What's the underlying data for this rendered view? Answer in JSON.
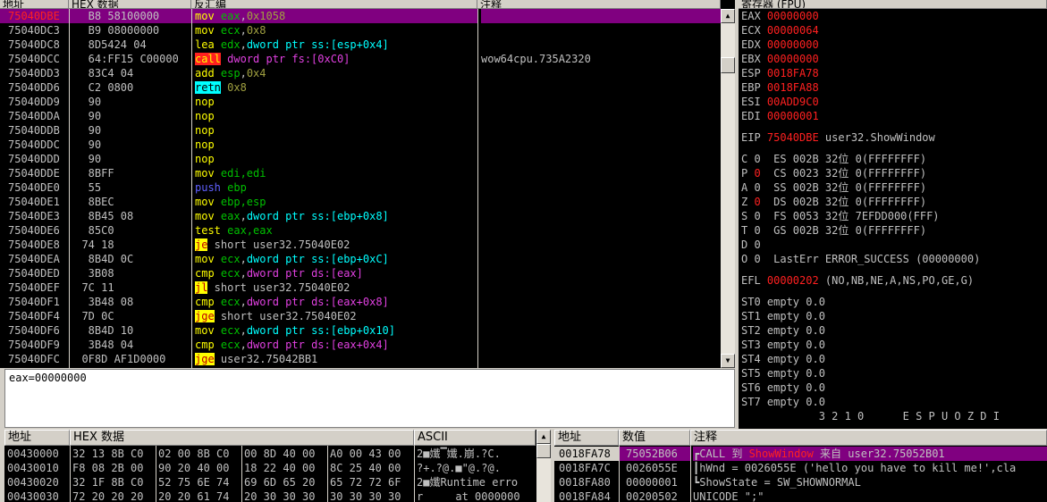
{
  "disasm": {
    "headers": [
      "地址",
      "HEX 数据",
      "反汇编",
      "注释"
    ],
    "rows": [
      {
        "addr": "75040DBE",
        "hex": "B8 58100000",
        "ops": [
          [
            "mov ",
            "y"
          ],
          [
            "eax",
            "g"
          ],
          [
            ",",
            "w"
          ],
          [
            "0x1058",
            "ol"
          ]
        ],
        "comment": "",
        "selected": true
      },
      {
        "addr": "75040DC3",
        "hex": "B9 08000000",
        "ops": [
          [
            "mov ",
            "y"
          ],
          [
            "ecx",
            "g"
          ],
          [
            ",",
            "w"
          ],
          [
            "0x8",
            "ol"
          ]
        ],
        "comment": ""
      },
      {
        "addr": "75040DC8",
        "hex": "8D5424 04",
        "ops": [
          [
            "lea ",
            "y"
          ],
          [
            "edx",
            "g"
          ],
          [
            ",",
            "w"
          ],
          [
            "dword ptr ss:[esp+0x4]",
            "cy"
          ]
        ],
        "comment": ""
      },
      {
        "addr": "75040DCC",
        "hex": "64:FF15 C00000",
        "ops": [
          [
            "call",
            "callbox"
          ],
          [
            " dword ptr fs:[0xC0]",
            "m"
          ]
        ],
        "comment": "wow64cpu.735A2320"
      },
      {
        "addr": "75040DD3",
        "hex": "83C4 04",
        "ops": [
          [
            "add ",
            "y"
          ],
          [
            "esp",
            "g"
          ],
          [
            ",",
            "w"
          ],
          [
            "0x4",
            "ol"
          ]
        ],
        "comment": ""
      },
      {
        "addr": "75040DD6",
        "hex": "C2 0800",
        "ops": [
          [
            "retn",
            "retbox"
          ],
          [
            " 0x8",
            "ol"
          ]
        ],
        "comment": ""
      },
      {
        "addr": "75040DD9",
        "hex": "90",
        "ops": [
          [
            "nop",
            "y"
          ]
        ],
        "comment": ""
      },
      {
        "addr": "75040DDA",
        "hex": "90",
        "ops": [
          [
            "nop",
            "y"
          ]
        ],
        "comment": ""
      },
      {
        "addr": "75040DDB",
        "hex": "90",
        "ops": [
          [
            "nop",
            "y"
          ]
        ],
        "comment": ""
      },
      {
        "addr": "75040DDC",
        "hex": "90",
        "ops": [
          [
            "nop",
            "y"
          ]
        ],
        "comment": ""
      },
      {
        "addr": "75040DDD",
        "hex": "90",
        "ops": [
          [
            "nop",
            "y"
          ]
        ],
        "comment": ""
      },
      {
        "addr": "75040DDE",
        "hex": "8BFF",
        "ops": [
          [
            "mov ",
            "y"
          ],
          [
            "edi,edi",
            "g"
          ]
        ],
        "comment": ""
      },
      {
        "addr": "75040DE0",
        "hex": "55",
        "ops": [
          [
            "push ",
            "pushc"
          ],
          [
            "ebp",
            "g"
          ]
        ],
        "comment": ""
      },
      {
        "addr": "75040DE1",
        "hex": "8BEC",
        "ops": [
          [
            "mov ",
            "y"
          ],
          [
            "ebp,esp",
            "g"
          ]
        ],
        "comment": ""
      },
      {
        "addr": "75040DE3",
        "hex": "8B45 08",
        "ops": [
          [
            "mov ",
            "y"
          ],
          [
            "eax",
            "g"
          ],
          [
            ",",
            "w"
          ],
          [
            "dword ptr ss:[ebp+0x8]",
            "cy"
          ]
        ],
        "comment": ""
      },
      {
        "addr": "75040DE6",
        "hex": "85C0",
        "ops": [
          [
            "test ",
            "y"
          ],
          [
            "eax,eax",
            "g"
          ]
        ],
        "comment": ""
      },
      {
        "addr": "75040DE8",
        "hex": "74 18",
        "ops": [
          [
            "je",
            "jbox"
          ],
          [
            " short user32.75040E02",
            "w"
          ]
        ],
        "comment": "",
        "hexarrow": true
      },
      {
        "addr": "75040DEA",
        "hex": "8B4D 0C",
        "ops": [
          [
            "mov ",
            "y"
          ],
          [
            "ecx",
            "g"
          ],
          [
            ",",
            "w"
          ],
          [
            "dword ptr ss:[ebp+0xC]",
            "cy"
          ]
        ],
        "comment": ""
      },
      {
        "addr": "75040DED",
        "hex": "3B08",
        "ops": [
          [
            "cmp ",
            "y"
          ],
          [
            "ecx",
            "g"
          ],
          [
            ",",
            "w"
          ],
          [
            "dword ptr ds:[eax]",
            "m"
          ]
        ],
        "comment": ""
      },
      {
        "addr": "75040DEF",
        "hex": "7C 11",
        "ops": [
          [
            "jl",
            "jbox"
          ],
          [
            " short user32.75040E02",
            "w"
          ]
        ],
        "comment": "",
        "hexarrow": true
      },
      {
        "addr": "75040DF1",
        "hex": "3B48 08",
        "ops": [
          [
            "cmp ",
            "y"
          ],
          [
            "ecx",
            "g"
          ],
          [
            ",",
            "w"
          ],
          [
            "dword ptr ds:[eax+0x8]",
            "m"
          ]
        ],
        "comment": ""
      },
      {
        "addr": "75040DF4",
        "hex": "7D 0C",
        "ops": [
          [
            "jge",
            "jbox"
          ],
          [
            " short user32.75040E02",
            "w"
          ]
        ],
        "comment": "",
        "hexarrow": true
      },
      {
        "addr": "75040DF6",
        "hex": "8B4D 10",
        "ops": [
          [
            "mov ",
            "y"
          ],
          [
            "ecx",
            "g"
          ],
          [
            ",",
            "w"
          ],
          [
            "dword ptr ss:[ebp+0x10]",
            "cy"
          ]
        ],
        "comment": ""
      },
      {
        "addr": "75040DF9",
        "hex": "3B48 04",
        "ops": [
          [
            "cmp ",
            "y"
          ],
          [
            "ecx",
            "g"
          ],
          [
            ",",
            "w"
          ],
          [
            "dword ptr ds:[eax+0x4]",
            "m"
          ]
        ],
        "comment": ""
      },
      {
        "addr": "75040DFC",
        "hex": "0F8D AF1D0000",
        "ops": [
          [
            "jge",
            "jbox"
          ],
          [
            " user32.75042BB1",
            "w"
          ]
        ],
        "comment": "",
        "hexarrow": true
      }
    ]
  },
  "info_line": "eax=00000000",
  "registers": {
    "title": "寄存器 (FPU)",
    "gp": [
      [
        "EAX",
        "00000000"
      ],
      [
        "ECX",
        "00000064"
      ],
      [
        "EDX",
        "00000000"
      ],
      [
        "EBX",
        "00000000"
      ],
      [
        "ESP",
        "0018FA78"
      ],
      [
        "EBP",
        "0018FA88"
      ],
      [
        "ESI",
        "00ADD9C0"
      ],
      [
        "EDI",
        "00000001"
      ]
    ],
    "eip": {
      "name": "EIP",
      "value": "75040DBE",
      "sym": "user32.ShowWindow"
    },
    "flags": [
      {
        "f": "C",
        "v": "0",
        "red": false,
        "seg": "ES 002B 32位 0(FFFFFFFF)"
      },
      {
        "f": "P",
        "v": "0",
        "red": true,
        "seg": "CS 0023 32位 0(FFFFFFFF)"
      },
      {
        "f": "A",
        "v": "0",
        "red": false,
        "seg": "SS 002B 32位 0(FFFFFFFF)"
      },
      {
        "f": "Z",
        "v": "0",
        "red": true,
        "seg": "DS 002B 32位 0(FFFFFFFF)"
      },
      {
        "f": "S",
        "v": "0",
        "red": false,
        "seg": "FS 0053 32位 7EFDD000(FFF)"
      },
      {
        "f": "T",
        "v": "0",
        "red": false,
        "seg": "GS 002B 32位 0(FFFFFFFF)"
      },
      {
        "f": "D",
        "v": "0",
        "red": false,
        "seg": ""
      },
      {
        "f": "O",
        "v": "0",
        "red": false,
        "seg": "LastErr ERROR_SUCCESS (00000000)"
      }
    ],
    "efl": {
      "name": "EFL",
      "value": "00000202",
      "desc": "(NO,NB,NE,A,NS,PO,GE,G)"
    },
    "st": [
      "ST0 empty 0.0",
      "ST1 empty 0.0",
      "ST2 empty 0.0",
      "ST3 empty 0.0",
      "ST4 empty 0.0",
      "ST5 empty 0.0",
      "ST6 empty 0.0",
      "ST7 empty 0.0"
    ],
    "fpu_flags": "3 2 1 0      E S P U O Z D I"
  },
  "dump": {
    "headers": [
      "地址",
      "HEX 数据",
      "ASCII"
    ],
    "rows": [
      {
        "addr": "00430000",
        "hex": [
          "32 13 8B C0",
          "02 00 8B C0",
          "00 8D 40 00",
          "A0 00 43 00"
        ],
        "ascii": "2■孅▔孅.崩.?C."
      },
      {
        "addr": "00430010",
        "hex": [
          "F8 08 2B 00",
          "90 20 40 00",
          "18 22 40 00",
          "8C 25 40 00"
        ],
        "ascii": "?+.?@.■\"@.?@."
      },
      {
        "addr": "00430020",
        "hex": [
          "32 1F 8B C0",
          "52 75 6E 74",
          "69 6D 65 20",
          "65 72 72 6F"
        ],
        "ascii": "2■孅Runtime erro"
      },
      {
        "addr": "00430030",
        "hex": [
          "72 20 20 20",
          "20 20 61 74",
          "20 30 30 30",
          "30 30 30 30"
        ],
        "ascii": "r     at 0000000"
      }
    ]
  },
  "stack": {
    "headers": [
      "地址",
      "数值",
      "注释"
    ],
    "rows": [
      {
        "addr": "0018FA78",
        "val": "75052B06",
        "comment": [
          [
            "┏CALL 到 ",
            "w"
          ],
          [
            "ShowWindow",
            "red"
          ],
          [
            " 来自 user32.75052B01",
            "w"
          ]
        ],
        "selected": true
      },
      {
        "addr": "0018FA7C",
        "val": "0026055E",
        "comment": [
          [
            "┃hWnd = 0026055E ('hello you have to kill me!',cla",
            "w"
          ]
        ]
      },
      {
        "addr": "0018FA80",
        "val": "00000001",
        "comment": [
          [
            "┗ShowState = SW_SHOWNORMAL",
            "w"
          ]
        ]
      },
      {
        "addr": "0018FA84",
        "val": "00200502",
        "comment": [
          [
            "UNICODE \";\"",
            "w"
          ]
        ]
      }
    ]
  }
}
